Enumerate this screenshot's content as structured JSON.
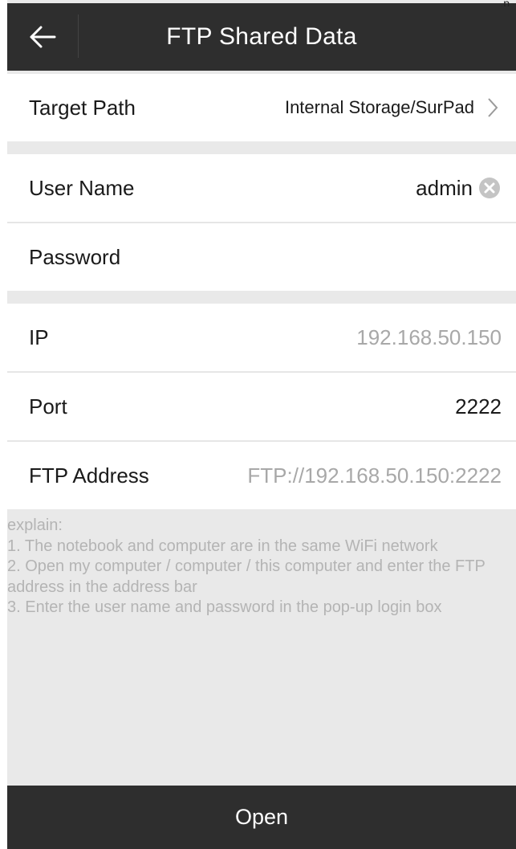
{
  "topcrop_text": ",p",
  "header": {
    "title": "FTP Shared Data",
    "back_icon": "arrow-left-icon"
  },
  "target_path": {
    "label": "Target Path",
    "value": "Internal Storage/SurPad",
    "icon": "chevron-right-icon"
  },
  "user_name": {
    "label": "User Name",
    "value": "admin",
    "clear_icon": "clear-circle-icon"
  },
  "password": {
    "label": "Password",
    "value": ""
  },
  "ip": {
    "label": "IP",
    "value": "192.168.50.150"
  },
  "port": {
    "label": "Port",
    "value": "2222"
  },
  "ftp_address": {
    "label": "FTP Address",
    "value": "FTP://192.168.50.150:2222"
  },
  "explain": {
    "heading": "explain:",
    "lines": [
      "1. The notebook and computer are in the same WiFi network",
      "2. Open my computer / computer / this computer and enter the FTP address in the address bar",
      "3. Enter the user name and password in the pop-up login box"
    ]
  },
  "footer": {
    "open_label": "Open"
  },
  "colors": {
    "bar": "#2e2e2e",
    "background": "#e9e9e9",
    "muted_text": "#a8a8a8"
  }
}
